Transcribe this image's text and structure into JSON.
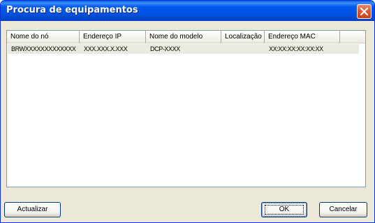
{
  "window": {
    "title": "Procura de equipamentos"
  },
  "list": {
    "columns": [
      "Nome do nó",
      "Endereço IP",
      "Nome do modelo",
      "Localização",
      "Endereço MAC"
    ],
    "rows": [
      [
        "BRWXXXXXXXXXXXXX",
        "XXX.XXX.X.XXX",
        "DCP-XXXX",
        "",
        "XX:XX:XX:XX:XX:XX"
      ]
    ]
  },
  "buttons": {
    "refresh": "Actualizar",
    "ok": "OK",
    "cancel": "Cancelar"
  },
  "icons": {
    "close": "close-icon"
  },
  "colors": {
    "titlebar": "#0054e3",
    "close": "#d95a35",
    "dialog_bg": "#ece9d8"
  }
}
